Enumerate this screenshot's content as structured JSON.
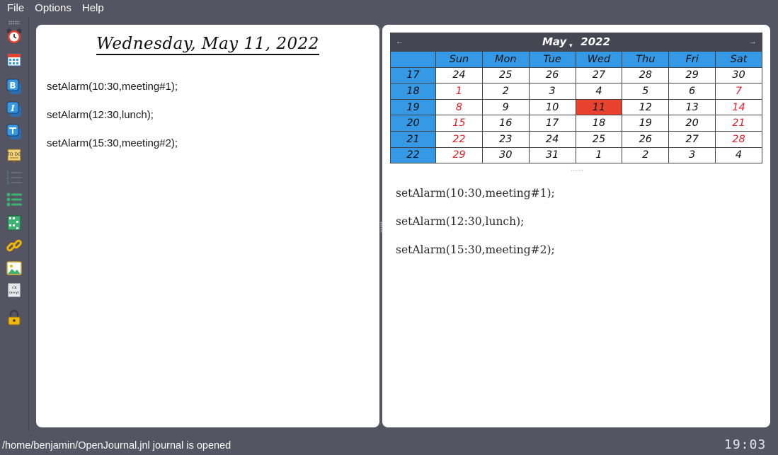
{
  "menu": {
    "file": "File",
    "options": "Options",
    "help": "Help"
  },
  "toolbar": {
    "icons": [
      "alarm-clock-icon",
      "calendar-icon",
      "bold-icon",
      "italic-icon",
      "table-icon",
      "todo-icon",
      "numbered-list-icon",
      "bullet-list-icon",
      "grid-icon",
      "link-icon",
      "image-icon",
      "formula-icon",
      "lock-icon"
    ]
  },
  "editor": {
    "date_title": "Wednesday, May 11, 2022",
    "lines": [
      "setAlarm(10:30,meeting#1);",
      "setAlarm(12:30,lunch);",
      "setAlarm(15:30,meeting#2);"
    ]
  },
  "calendar": {
    "prev_arrow": "←",
    "next_arrow": "→",
    "month": "May",
    "year": "2022",
    "days": [
      "Sun",
      "Mon",
      "Tue",
      "Wed",
      "Thu",
      "Fri",
      "Sat"
    ],
    "weeks": [
      {
        "week": "17",
        "days": [
          "24",
          "25",
          "26",
          "27",
          "28",
          "29",
          "30"
        ]
      },
      {
        "week": "18",
        "days": [
          "1",
          "2",
          "3",
          "4",
          "5",
          "6",
          "7"
        ]
      },
      {
        "week": "19",
        "days": [
          "8",
          "9",
          "10",
          "11",
          "12",
          "13",
          "14"
        ]
      },
      {
        "week": "20",
        "days": [
          "15",
          "16",
          "17",
          "18",
          "19",
          "20",
          "21"
        ]
      },
      {
        "week": "21",
        "days": [
          "22",
          "23",
          "24",
          "25",
          "26",
          "27",
          "28"
        ]
      },
      {
        "week": "22",
        "days": [
          "29",
          "30",
          "31",
          "1",
          "2",
          "3",
          "4"
        ]
      }
    ],
    "selected": "11",
    "colors": {
      "header": "#464652",
      "week_bg": "#3599e6",
      "weekend": "#e2202a",
      "selected": "#e8412d"
    }
  },
  "preview": {
    "lines": [
      "setAlarm(10:30,meeting#1);",
      "setAlarm(12:30,lunch);",
      "setAlarm(15:30,meeting#2);"
    ]
  },
  "status": {
    "message": "/home/benjamin/OpenJournal.jnl journal is opened",
    "clock": "19:03"
  },
  "colors": {
    "background": "#545462",
    "panel": "#ffffff"
  }
}
